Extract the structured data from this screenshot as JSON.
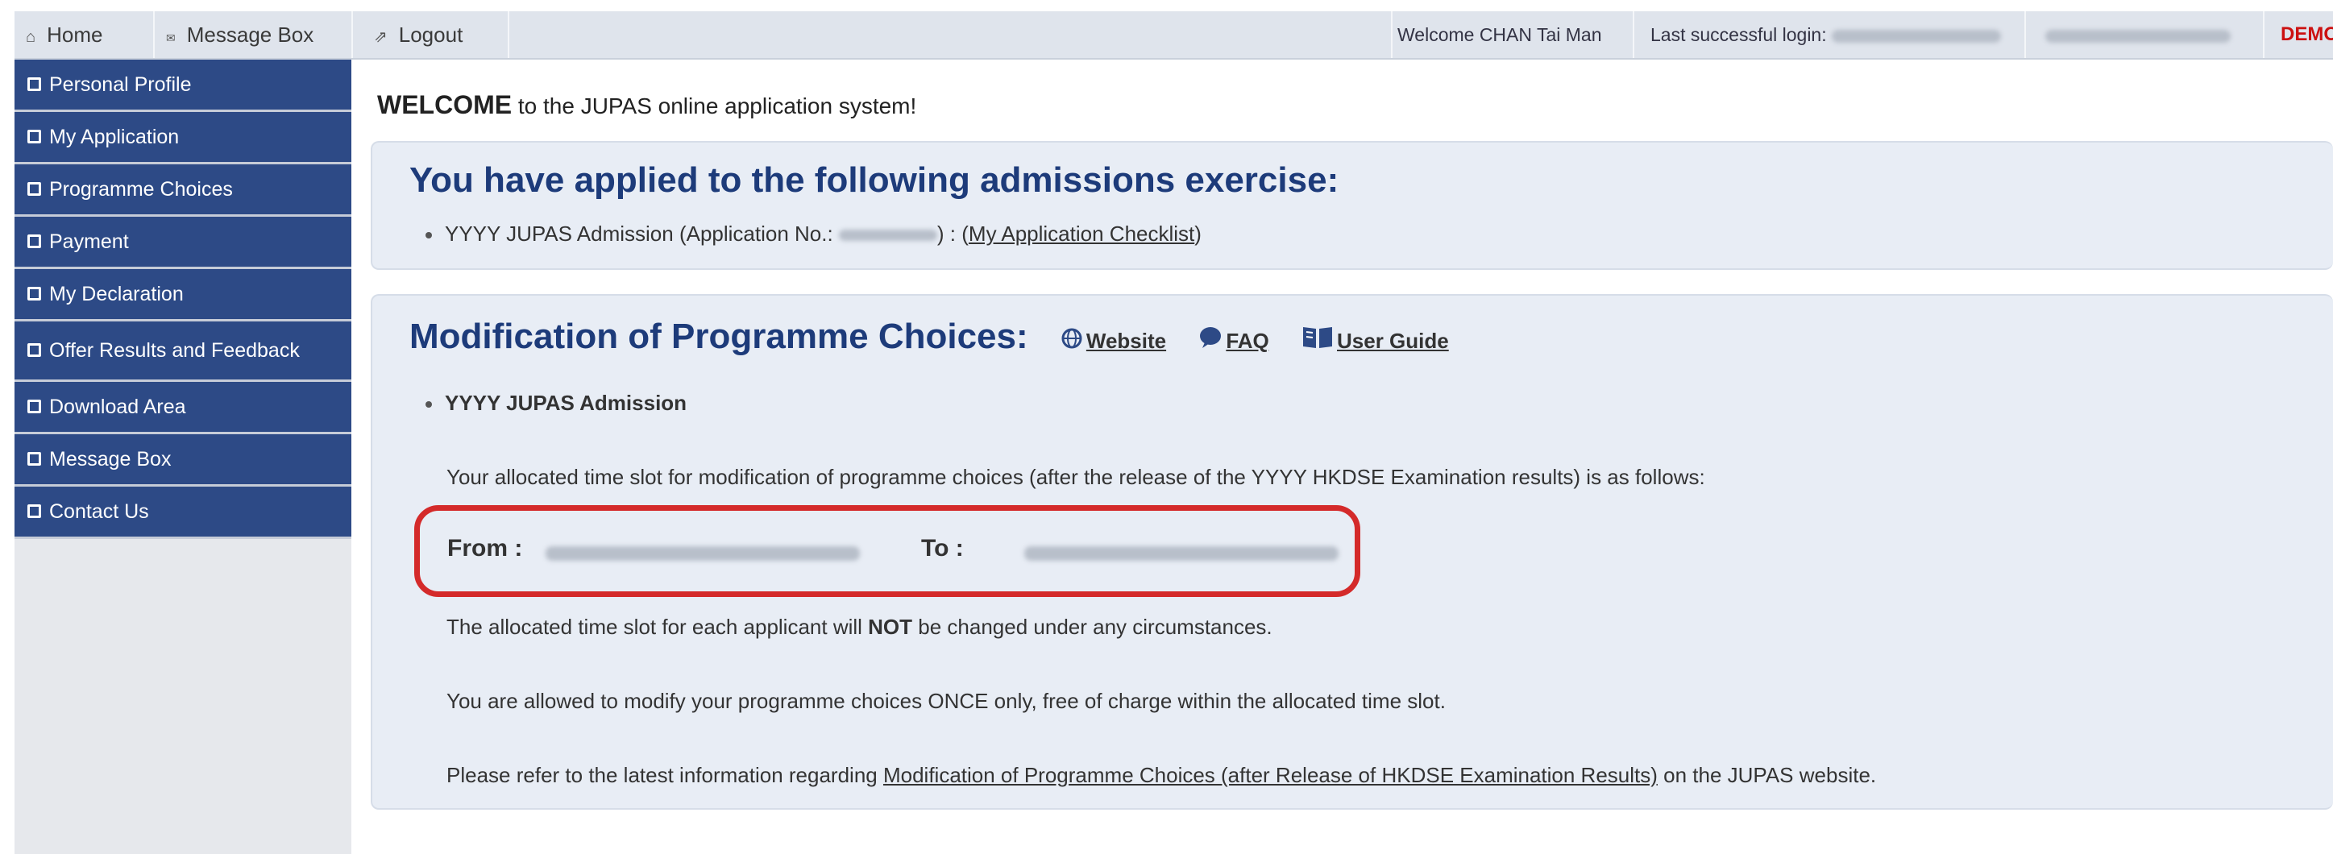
{
  "topbar": {
    "home_label": "Home",
    "message_box_label": "Message Box",
    "logout_label": "Logout",
    "welcome_user": "Welcome CHAN Tai Man",
    "last_login_label": "Last successful login:",
    "demo_label": "DEMO"
  },
  "sidebar": {
    "items": [
      {
        "label": "Personal Profile"
      },
      {
        "label": "My Application"
      },
      {
        "label": "Programme Choices"
      },
      {
        "label": "Payment"
      },
      {
        "label": "My Declaration"
      },
      {
        "label": "Offer Results and Feedback"
      },
      {
        "label": "Download Area"
      },
      {
        "label": "Message Box"
      },
      {
        "label": "Contact Us"
      }
    ]
  },
  "main": {
    "welcome_bold": "WELCOME",
    "welcome_rest": " to the JUPAS online application system!",
    "applied": {
      "heading": "You have applied to the following admissions exercise:",
      "item_prefix": "YYYY JUPAS Admission (Application No.: ",
      "item_mid": ") : (",
      "checklist_link": "My Application Checklist",
      "item_suffix": ")"
    },
    "modification": {
      "heading": "Modification of Programme Choices:",
      "website_link": "Website",
      "faq_link": "FAQ",
      "guide_link": "User Guide",
      "admission_item": "YYYY JUPAS Admission",
      "slot_intro": "Your allocated time slot for modification of programme choices (after the release of the YYYY HKDSE Examination results) is as follows:",
      "from_label": "From :",
      "to_label": "To :",
      "not_changed_prefix": "The allocated time slot for each applicant will ",
      "not_changed_bold": "NOT",
      "not_changed_suffix": " be changed under any circumstances.",
      "once_text": "You are allowed to modify your programme choices ONCE only, free of charge within the allocated time slot.",
      "refer_prefix": "Please refer to the latest information regarding ",
      "refer_link": "Modification of Programme Choices (after Release of HKDSE Examination Results)",
      "refer_suffix": " on the JUPAS website."
    }
  },
  "colors": {
    "nav_blue": "#2d4a86",
    "heading_blue": "#1d3b7a",
    "highlight_red": "#d42a2a",
    "demo_red": "#cc1111"
  },
  "icons": [
    "home-icon",
    "message-box-icon",
    "logout-icon",
    "globe-icon",
    "faq-bubble-icon",
    "book-icon"
  ]
}
